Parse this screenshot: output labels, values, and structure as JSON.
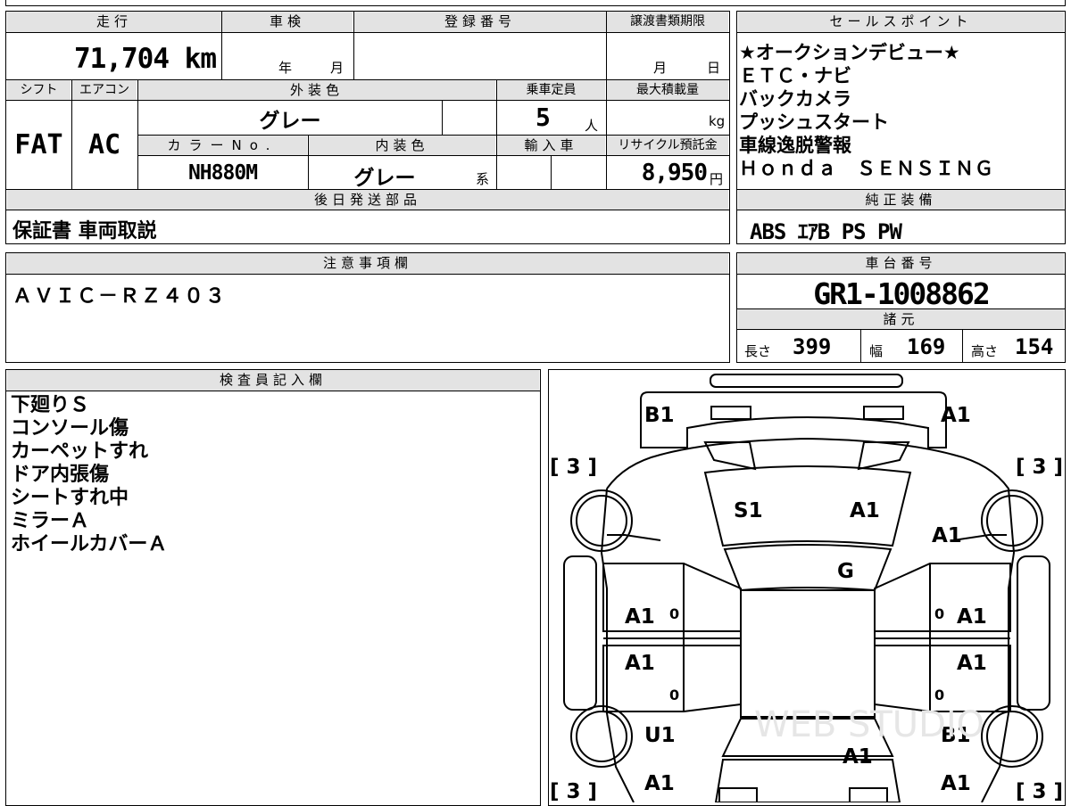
{
  "vehicle_info": {
    "mileage": {
      "label": "走行",
      "value": "71,704 km"
    },
    "inspection": {
      "label": "車検",
      "year_unit": "年",
      "month_unit": "月",
      "value": ""
    },
    "registration_number": {
      "label": "登録番号",
      "value": ""
    },
    "transfer_deadline": {
      "label": "譲渡書類期限",
      "month_unit": "月",
      "day_unit": "日"
    },
    "shift": {
      "label": "シフト",
      "value": "FAT"
    },
    "aircon": {
      "label": "エアコン",
      "value": "AC"
    },
    "exterior_color": {
      "label": "外装色",
      "value": "グレー"
    },
    "capacity": {
      "label": "乗車定員",
      "value": "5",
      "unit": "人"
    },
    "max_load": {
      "label": "最大積載量",
      "value": "",
      "unit": "kg"
    },
    "color_no": {
      "label": "カラーNo.",
      "value": "NH880M"
    },
    "interior_color": {
      "label": "内装色",
      "value": "グレー",
      "suffix": "系"
    },
    "import_car": {
      "label": "輸入車",
      "value": ""
    },
    "recycle_deposit": {
      "label": "リサイクル預託金",
      "value": "8,950",
      "unit": "円"
    },
    "later_parts": {
      "label": "後日発送部品",
      "value": "保証書 車両取説"
    }
  },
  "sales_points": {
    "label": "セールスポイント",
    "items": [
      "★オークションデビュー★",
      "ＥＴＣ・ナビ",
      "バックカメラ",
      "プッシュスタート",
      "車線逸脱警報",
      "Ｈｏｎｄａ　ＳＥＮＳＩＮＧ"
    ]
  },
  "genuine_equipment": {
    "label": "純正装備",
    "value": "ABS ｴｱB PS PW"
  },
  "notes": {
    "label": "注意事項欄",
    "value": "ＡＶＩＣ－ＲＺ４０３"
  },
  "chassis": {
    "label": "車台番号",
    "value": "GR1-1008862"
  },
  "specs": {
    "label": "諸元",
    "length": {
      "label": "長さ",
      "value": "399"
    },
    "width": {
      "label": "幅",
      "value": "169"
    },
    "height": {
      "label": "高さ",
      "value": "154"
    }
  },
  "inspector": {
    "label": "検査員記入欄",
    "lines": [
      "下廻りＳ",
      "コンソール傷",
      "カーペットすれ",
      "ドア内張傷",
      "シートすれ中",
      "ミラーＡ",
      "ホイールカバーＡ"
    ]
  },
  "diagram": {
    "tire_left_front": "[ 3 ]",
    "tire_right_front": "[ 3 ]",
    "tire_left_rear": "[ 3 ]",
    "tire_right_rear": "[ 3 ]",
    "front_bumper_left": "B1",
    "front_bumper_right": "A1",
    "hood_left": "S1",
    "hood_right": "A1",
    "right_fender": "A1",
    "windshield": "G",
    "left_front_door": "A1",
    "right_front_door": "A1",
    "left_rear_door": "A1",
    "right_rear_door": "A1",
    "left_rear_quarter": "U1",
    "right_rear_quarter": "B1",
    "trunk": "A1",
    "rear_left": "A1",
    "rear_right": "A1",
    "door_marks": [
      "0",
      "0",
      "0",
      "0"
    ],
    "watermark": "WEB STUDIO"
  }
}
